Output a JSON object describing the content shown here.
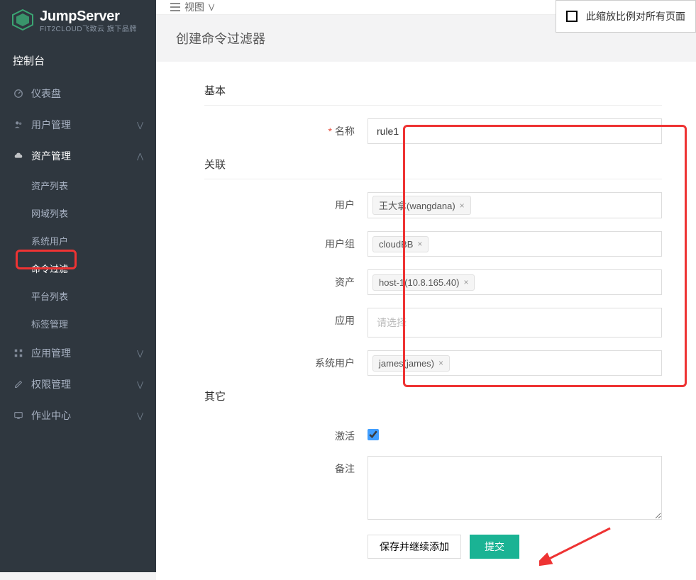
{
  "brand": {
    "title": "JumpServer",
    "subtitle": "FIT2CLOUD飞致云 旗下品牌"
  },
  "console_label": "控制台",
  "zoom_notice": "此缩放比例对所有页面",
  "view_toggle": "视图",
  "page_title": "创建命令过滤器",
  "sidebar": {
    "items": [
      {
        "label": "仪表盘",
        "icon": "dashboard"
      },
      {
        "label": "用户管理",
        "icon": "users",
        "chev": true
      },
      {
        "label": "资产管理",
        "icon": "cloud",
        "chev": true,
        "active": true
      },
      {
        "label": "应用管理",
        "icon": "grid",
        "chev": true
      },
      {
        "label": "权限管理",
        "icon": "edit",
        "chev": true
      },
      {
        "label": "作业中心",
        "icon": "monitor",
        "chev": true
      }
    ],
    "asset_submenu": [
      {
        "label": "资产列表"
      },
      {
        "label": "网域列表"
      },
      {
        "label": "系统用户"
      },
      {
        "label": "命令过滤",
        "highlight": true
      },
      {
        "label": "平台列表"
      },
      {
        "label": "标签管理"
      }
    ]
  },
  "sections": {
    "basic": "基本",
    "relation": "关联",
    "other": "其它"
  },
  "fields": {
    "name": {
      "label": "名称",
      "value": "rule1"
    },
    "user": {
      "label": "用户",
      "tags": [
        "王大拿(wangdana)"
      ]
    },
    "usergroup": {
      "label": "用户组",
      "tags": [
        "cloudBB"
      ]
    },
    "asset": {
      "label": "资产",
      "tags": [
        "host-1(10.8.165.40)"
      ]
    },
    "app": {
      "label": "应用",
      "placeholder": "请选择"
    },
    "sysuser": {
      "label": "系统用户",
      "tags": [
        "james(james)"
      ]
    },
    "active": {
      "label": "激活",
      "checked": true
    },
    "remark": {
      "label": "备注",
      "value": ""
    }
  },
  "buttons": {
    "save_continue": "保存并继续添加",
    "submit": "提交"
  }
}
